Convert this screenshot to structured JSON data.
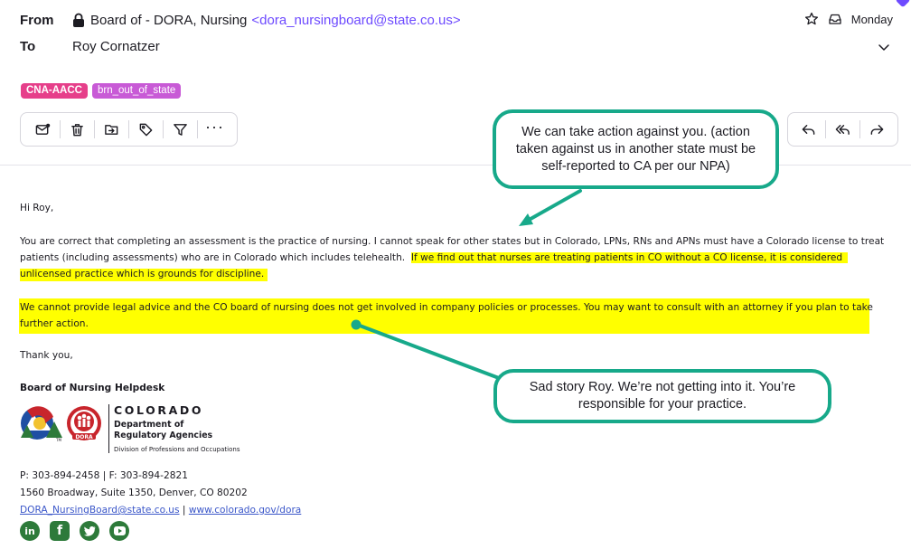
{
  "header": {
    "from_label": "From",
    "from_name": "Board of - DORA, Nursing",
    "from_email": "<dora_nursingboard@state.co.us>",
    "to_label": "To",
    "to_name": "Roy Cornatzer",
    "date": "Monday"
  },
  "labels": [
    "CNA-AACC",
    "brn_out_of_state"
  ],
  "body": {
    "greeting": "Hi Roy,",
    "para1_a": "You are correct that completing an assessment is the practice of nursing.  I cannot speak for other states but in Colorado, LPNs, RNs and APNs must have a Colorado license to treat",
    "para1_b": "patients (including assessments) who are in Colorado which includes telehealth.  ",
    "para1_hl1": "If we find out that nurses are treating patients in CO without a CO license, it is considered",
    "para1_hl2": "unlicensed practice which is grounds for discipline.",
    "para2_hl1": "We cannot provide legal advice and the CO board of nursing does not get involved in company policies or processes. You may want to consult with an attorney if you plan to take",
    "para2_hl2": "further action.",
    "closing": "Thank you,",
    "signature": "Board of Nursing Helpdesk"
  },
  "logo": {
    "wordmark": "COLORADO",
    "dept_line1": "Department of",
    "dept_line2": "Regulatory Agencies",
    "division": "Division of Professions and Occupations",
    "badge_text": "DORA",
    "tm": "TM"
  },
  "contact": {
    "phones": "P: 303-894-2458 | F: 303-894-2821",
    "address": "1560 Broadway, Suite 1350, Denver, CO 80202",
    "email_link": "DORA_NursingBoard@state.co.us",
    "separator": " | ",
    "web_link": "www.colorado.gov/dora"
  },
  "social_icons": [
    "linkedin-icon",
    "facebook-icon",
    "twitter-icon",
    "youtube-icon"
  ],
  "annotations": {
    "bubble1": "We can take action against you. (action taken against us in another state must be self-reported to CA per our NPA)",
    "bubble2": "Sad story Roy. We’re not getting into it. You’re responsible for your practice."
  },
  "colors": {
    "accent": "#6d4aff",
    "highlight": "#ffff00",
    "annotation": "#17a98a",
    "label_cna": "#e63f8a",
    "label_brn": "#c85ad6"
  }
}
